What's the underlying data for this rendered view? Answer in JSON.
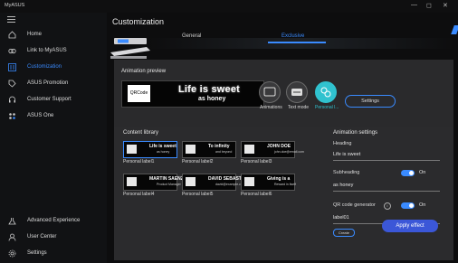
{
  "app": {
    "title": "MyASUS",
    "window_controls": [
      "—",
      "◻",
      "✕"
    ]
  },
  "sidebar": {
    "items": [
      {
        "label": "Home",
        "icon": "home-icon"
      },
      {
        "label": "Link to MyASUS",
        "icon": "link-icon"
      },
      {
        "label": "Customization",
        "icon": "customization-icon",
        "active": true
      },
      {
        "label": "ASUS Promotion",
        "icon": "tag-icon"
      },
      {
        "label": "Customer Support",
        "icon": "support-icon"
      },
      {
        "label": "ASUS One",
        "icon": "asus-one-icon"
      }
    ],
    "bottom_items": [
      {
        "label": "Advanced Experience",
        "icon": "flask-icon"
      },
      {
        "label": "User Center",
        "icon": "user-icon"
      },
      {
        "label": "Settings",
        "icon": "gear-icon"
      }
    ]
  },
  "page": {
    "title": "Customization",
    "tabs": [
      {
        "label": "General"
      },
      {
        "label": "Exclusive",
        "active": true
      }
    ]
  },
  "preview": {
    "title": "Animation preview",
    "qr_label": "QRCode",
    "heading": "Life is sweet",
    "subheading": "as honey",
    "modes": [
      "Animations",
      "Text mode",
      "Personal l..."
    ],
    "settings_button": "Settings"
  },
  "library": {
    "title": "Content library",
    "items": [
      {
        "label": "Personal label1",
        "heading": "Life is sweet",
        "sub": "as honey",
        "selected": true
      },
      {
        "label": "Personal label2",
        "heading": "To infinity",
        "sub": "and beyond"
      },
      {
        "label": "Personal label3",
        "heading": "JOHN DOE",
        "sub": "john.doe@email.com"
      },
      {
        "label": "Personal label4",
        "heading": "MARTIN SAENZ",
        "sub": "Product Manager & Web Dev"
      },
      {
        "label": "Personal label5",
        "heading": "DAVID SEBASTIAN",
        "sub": "david@example.com"
      },
      {
        "label": "Personal label6",
        "heading": "Giving is a",
        "sub": "Reward in itself"
      }
    ]
  },
  "animation_settings": {
    "title": "Animation settings",
    "heading_label": "Heading",
    "heading_value": "Life is sweet",
    "subheading_label": "Subheading",
    "subheading_toggle": "On",
    "subheading_value": "as honey",
    "qr_label": "QR code generator",
    "qr_toggle": "On",
    "qr_value": "label01",
    "create_button": "Create",
    "apply_button": "Apply effect"
  },
  "colors": {
    "accent": "#3a8bff",
    "teal": "#30c2cf",
    "apply": "#3b57d8"
  }
}
